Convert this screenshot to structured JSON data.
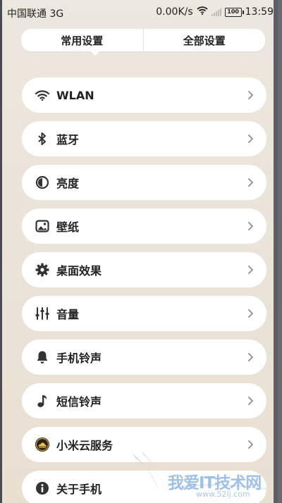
{
  "status_bar": {
    "carrier": "中国联通 3G",
    "speed": "0.00K/s",
    "battery": "100",
    "time": "13:59"
  },
  "tabs": [
    {
      "label": "常用设置",
      "active": true
    },
    {
      "label": "全部设置",
      "active": false
    }
  ],
  "items": [
    {
      "label": "WLAN",
      "icon": "wifi-icon"
    },
    {
      "label": "蓝牙",
      "icon": "bluetooth-icon"
    },
    {
      "label": "亮度",
      "icon": "brightness-icon"
    },
    {
      "label": "壁纸",
      "icon": "wallpaper-icon"
    },
    {
      "label": "桌面效果",
      "icon": "gear-icon"
    },
    {
      "label": "音量",
      "icon": "sliders-icon"
    },
    {
      "label": "手机铃声",
      "icon": "bell-icon"
    },
    {
      "label": "短信铃声",
      "icon": "music-note-icon"
    },
    {
      "label": "小米云服务",
      "icon": "cloud-service-icon"
    },
    {
      "label": "关于手机",
      "icon": "info-icon"
    }
  ],
  "watermark": {
    "text": "我爱IT技术网",
    "url": "www.52ij.com"
  },
  "colors": {
    "background": "#ebe4da",
    "card": "#ffffff",
    "text": "#222222",
    "chevron": "#9a9a9a",
    "watermark": "#8fb6e6"
  }
}
